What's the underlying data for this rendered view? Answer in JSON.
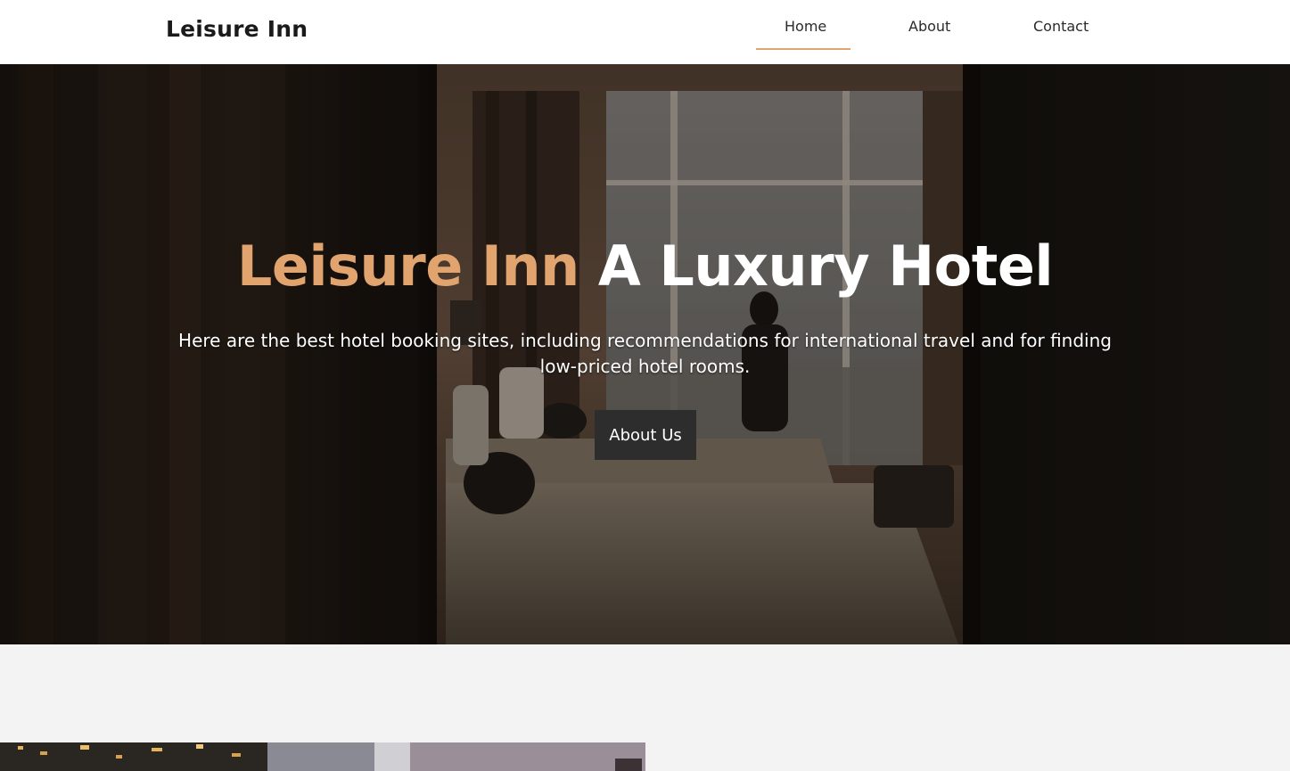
{
  "navbar": {
    "brand": "Leisure Inn",
    "links": [
      {
        "label": "Home",
        "active": true
      },
      {
        "label": "About",
        "active": false
      },
      {
        "label": "Contact",
        "active": false
      }
    ],
    "accent_color": "#e0a472"
  },
  "hero": {
    "title_accent": "Leisure Inn",
    "title_rest": "A Luxury Hotel",
    "subtitle": "Here are the best hotel booking sites, including recommendations for international travel and for finding low-priced hotel rooms.",
    "button_label": "About Us",
    "accent_color": "#e1a46f"
  }
}
